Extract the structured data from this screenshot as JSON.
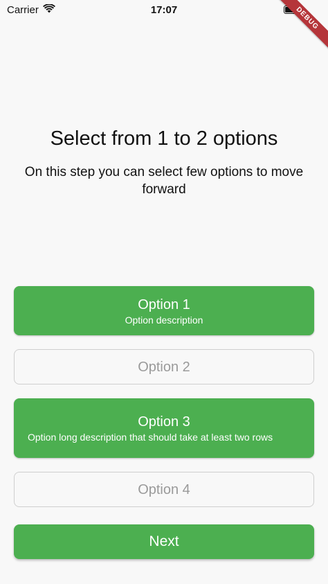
{
  "status_bar": {
    "carrier": "Carrier",
    "time": "17:07",
    "battery_level": 1.0
  },
  "debug_banner": "DEBUG",
  "header": {
    "title": "Select from 1 to 2 options",
    "subtitle": "On this step you can select few options to move forward"
  },
  "options": [
    {
      "title": "Option 1",
      "description": "Option description",
      "selected": true
    },
    {
      "title": "Option 2",
      "description": "",
      "selected": false
    },
    {
      "title": "Option 3",
      "description": "Option long description that should take at least two rows",
      "selected": true
    },
    {
      "title": "Option 4",
      "description": "",
      "selected": false
    }
  ],
  "next_button": {
    "label": "Next"
  },
  "colors": {
    "accent": "#4caf50",
    "background": "#f8f8f8",
    "unselected_border": "#cfcfcf",
    "unselected_text": "#9a9a9a",
    "debug_ribbon": "#b5353a"
  },
  "icons": {
    "wifi": "wifi-icon",
    "battery": "battery-icon"
  }
}
